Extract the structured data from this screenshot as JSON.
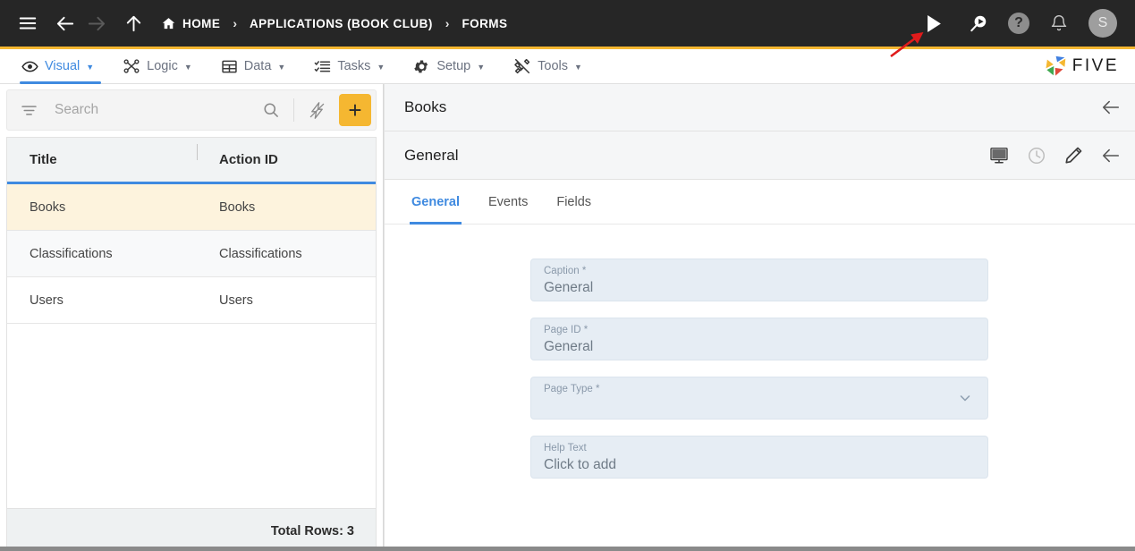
{
  "topbar": {
    "menu_icon": "hamburger-icon",
    "back_icon": "arrow-left-icon",
    "forward_icon": "arrow-right-icon",
    "up_icon": "arrow-up-icon",
    "breadcrumbs": [
      {
        "label": "HOME",
        "icon": "home-icon"
      },
      {
        "label": "APPLICATIONS (BOOK CLUB)",
        "icon": ""
      },
      {
        "label": "FORMS",
        "icon": ""
      }
    ],
    "separator": "›",
    "actions": [
      {
        "name": "run-icon",
        "label": "▶"
      },
      {
        "name": "search-run-icon",
        "label": ""
      },
      {
        "name": "help-icon",
        "label": "?"
      },
      {
        "name": "notifications-bell-icon",
        "label": ""
      }
    ],
    "avatar_initial": "S",
    "accent_gold": "#f5b731"
  },
  "navbar": {
    "items": [
      {
        "label": "Visual",
        "icon": "eye-icon",
        "caret": "▼",
        "active": true
      },
      {
        "label": "Logic",
        "icon": "logic-nodes-icon",
        "caret": "▼",
        "active": false
      },
      {
        "label": "Data",
        "icon": "table-grid-icon",
        "caret": "▼",
        "active": false
      },
      {
        "label": "Tasks",
        "icon": "checklist-icon",
        "caret": "▼",
        "active": false
      },
      {
        "label": "Setup",
        "icon": "gear-icon",
        "caret": "▼",
        "active": false
      },
      {
        "label": "Tools",
        "icon": "tools-icon",
        "caret": "▼",
        "active": false
      }
    ],
    "logo_text": "FIVE",
    "active_color": "#3f8ae0"
  },
  "left_panel": {
    "search": {
      "placeholder": "Search",
      "value": "",
      "filter_icon": "filter-icon",
      "search_icon": "search-icon",
      "lightning_icon": "lightning-bolt-icon",
      "add_label": "+"
    },
    "grid": {
      "columns": [
        "Title",
        "Action ID"
      ],
      "rows": [
        {
          "title": "Books",
          "action_id": "Books",
          "selected": true
        },
        {
          "title": "Classifications",
          "action_id": "Classifications",
          "selected": false
        },
        {
          "title": "Users",
          "action_id": "Users",
          "selected": false
        }
      ],
      "footer": "Total Rows: 3"
    }
  },
  "right_panel": {
    "header_title": "Books",
    "header_back_icon": "arrow-left-icon",
    "sub_header_title": "General",
    "sub_header_actions": [
      {
        "name": "display-designer-icon"
      },
      {
        "name": "history-clock-icon"
      },
      {
        "name": "edit-pencil-icon"
      },
      {
        "name": "arrow-left-icon"
      }
    ],
    "tabs": [
      {
        "label": "General",
        "active": true
      },
      {
        "label": "Events",
        "active": false
      },
      {
        "label": "Fields",
        "active": false
      }
    ],
    "form": {
      "fields": [
        {
          "label": "Caption *",
          "value": "General",
          "type": "text"
        },
        {
          "label": "Page ID *",
          "value": "General",
          "type": "text"
        },
        {
          "label": "Page Type *",
          "value": "",
          "type": "select"
        },
        {
          "label": "Help Text",
          "value": "Click to add",
          "type": "text"
        }
      ]
    }
  },
  "annotation": {
    "arrow_color": "#e01b1b",
    "points_to": "run-icon"
  }
}
